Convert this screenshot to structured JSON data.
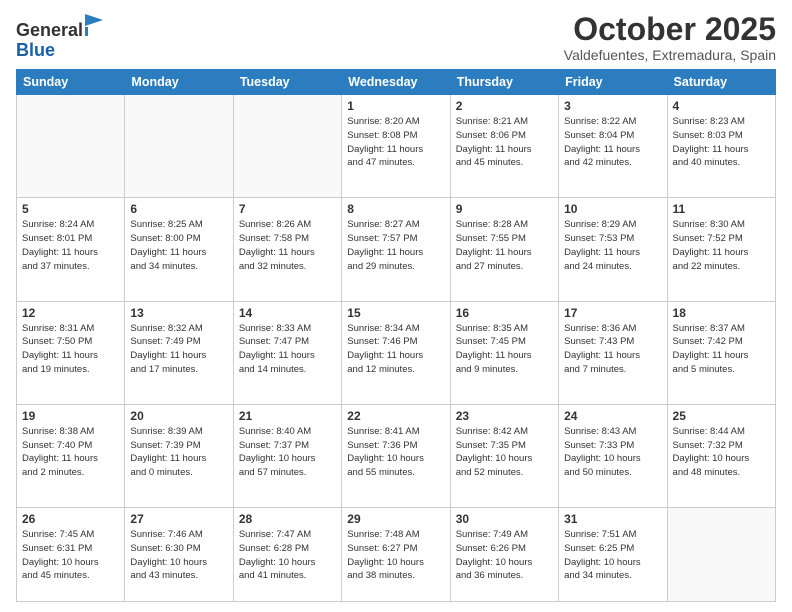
{
  "header": {
    "logo_general": "General",
    "logo_blue": "Blue",
    "month": "October 2025",
    "location": "Valdefuentes, Extremadura, Spain"
  },
  "weekdays": [
    "Sunday",
    "Monday",
    "Tuesday",
    "Wednesday",
    "Thursday",
    "Friday",
    "Saturday"
  ],
  "weeks": [
    [
      {
        "day": "",
        "info": ""
      },
      {
        "day": "",
        "info": ""
      },
      {
        "day": "",
        "info": ""
      },
      {
        "day": "1",
        "info": "Sunrise: 8:20 AM\nSunset: 8:08 PM\nDaylight: 11 hours\nand 47 minutes."
      },
      {
        "day": "2",
        "info": "Sunrise: 8:21 AM\nSunset: 8:06 PM\nDaylight: 11 hours\nand 45 minutes."
      },
      {
        "day": "3",
        "info": "Sunrise: 8:22 AM\nSunset: 8:04 PM\nDaylight: 11 hours\nand 42 minutes."
      },
      {
        "day": "4",
        "info": "Sunrise: 8:23 AM\nSunset: 8:03 PM\nDaylight: 11 hours\nand 40 minutes."
      }
    ],
    [
      {
        "day": "5",
        "info": "Sunrise: 8:24 AM\nSunset: 8:01 PM\nDaylight: 11 hours\nand 37 minutes."
      },
      {
        "day": "6",
        "info": "Sunrise: 8:25 AM\nSunset: 8:00 PM\nDaylight: 11 hours\nand 34 minutes."
      },
      {
        "day": "7",
        "info": "Sunrise: 8:26 AM\nSunset: 7:58 PM\nDaylight: 11 hours\nand 32 minutes."
      },
      {
        "day": "8",
        "info": "Sunrise: 8:27 AM\nSunset: 7:57 PM\nDaylight: 11 hours\nand 29 minutes."
      },
      {
        "day": "9",
        "info": "Sunrise: 8:28 AM\nSunset: 7:55 PM\nDaylight: 11 hours\nand 27 minutes."
      },
      {
        "day": "10",
        "info": "Sunrise: 8:29 AM\nSunset: 7:53 PM\nDaylight: 11 hours\nand 24 minutes."
      },
      {
        "day": "11",
        "info": "Sunrise: 8:30 AM\nSunset: 7:52 PM\nDaylight: 11 hours\nand 22 minutes."
      }
    ],
    [
      {
        "day": "12",
        "info": "Sunrise: 8:31 AM\nSunset: 7:50 PM\nDaylight: 11 hours\nand 19 minutes."
      },
      {
        "day": "13",
        "info": "Sunrise: 8:32 AM\nSunset: 7:49 PM\nDaylight: 11 hours\nand 17 minutes."
      },
      {
        "day": "14",
        "info": "Sunrise: 8:33 AM\nSunset: 7:47 PM\nDaylight: 11 hours\nand 14 minutes."
      },
      {
        "day": "15",
        "info": "Sunrise: 8:34 AM\nSunset: 7:46 PM\nDaylight: 11 hours\nand 12 minutes."
      },
      {
        "day": "16",
        "info": "Sunrise: 8:35 AM\nSunset: 7:45 PM\nDaylight: 11 hours\nand 9 minutes."
      },
      {
        "day": "17",
        "info": "Sunrise: 8:36 AM\nSunset: 7:43 PM\nDaylight: 11 hours\nand 7 minutes."
      },
      {
        "day": "18",
        "info": "Sunrise: 8:37 AM\nSunset: 7:42 PM\nDaylight: 11 hours\nand 5 minutes."
      }
    ],
    [
      {
        "day": "19",
        "info": "Sunrise: 8:38 AM\nSunset: 7:40 PM\nDaylight: 11 hours\nand 2 minutes."
      },
      {
        "day": "20",
        "info": "Sunrise: 8:39 AM\nSunset: 7:39 PM\nDaylight: 11 hours\nand 0 minutes."
      },
      {
        "day": "21",
        "info": "Sunrise: 8:40 AM\nSunset: 7:37 PM\nDaylight: 10 hours\nand 57 minutes."
      },
      {
        "day": "22",
        "info": "Sunrise: 8:41 AM\nSunset: 7:36 PM\nDaylight: 10 hours\nand 55 minutes."
      },
      {
        "day": "23",
        "info": "Sunrise: 8:42 AM\nSunset: 7:35 PM\nDaylight: 10 hours\nand 52 minutes."
      },
      {
        "day": "24",
        "info": "Sunrise: 8:43 AM\nSunset: 7:33 PM\nDaylight: 10 hours\nand 50 minutes."
      },
      {
        "day": "25",
        "info": "Sunrise: 8:44 AM\nSunset: 7:32 PM\nDaylight: 10 hours\nand 48 minutes."
      }
    ],
    [
      {
        "day": "26",
        "info": "Sunrise: 7:45 AM\nSunset: 6:31 PM\nDaylight: 10 hours\nand 45 minutes."
      },
      {
        "day": "27",
        "info": "Sunrise: 7:46 AM\nSunset: 6:30 PM\nDaylight: 10 hours\nand 43 minutes."
      },
      {
        "day": "28",
        "info": "Sunrise: 7:47 AM\nSunset: 6:28 PM\nDaylight: 10 hours\nand 41 minutes."
      },
      {
        "day": "29",
        "info": "Sunrise: 7:48 AM\nSunset: 6:27 PM\nDaylight: 10 hours\nand 38 minutes."
      },
      {
        "day": "30",
        "info": "Sunrise: 7:49 AM\nSunset: 6:26 PM\nDaylight: 10 hours\nand 36 minutes."
      },
      {
        "day": "31",
        "info": "Sunrise: 7:51 AM\nSunset: 6:25 PM\nDaylight: 10 hours\nand 34 minutes."
      },
      {
        "day": "",
        "info": ""
      }
    ]
  ]
}
